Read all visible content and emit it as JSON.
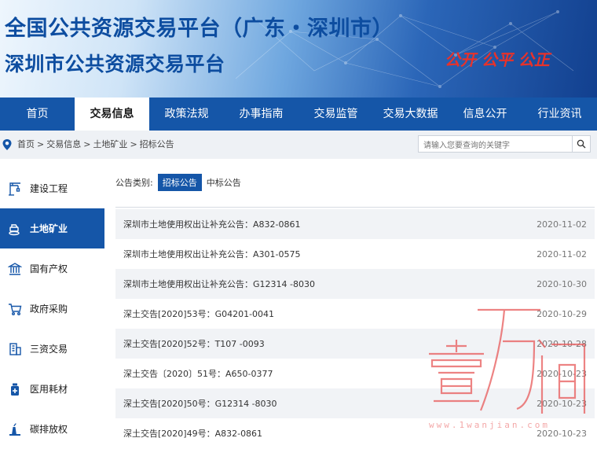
{
  "header": {
    "title_line1": "全国公共资源交易平台（广东・深圳市）",
    "title_line2": "深圳市公共资源交易平台",
    "slogan": "公开 公平 公正"
  },
  "nav": {
    "items": [
      {
        "label": "首页"
      },
      {
        "label": "交易信息",
        "active": true
      },
      {
        "label": "政策法规"
      },
      {
        "label": "办事指南"
      },
      {
        "label": "交易监管"
      },
      {
        "label": "交易大数据"
      },
      {
        "label": "信息公开"
      },
      {
        "label": "行业资讯"
      }
    ]
  },
  "breadcrumb": {
    "icon": "location-pin-icon",
    "items": [
      "首页",
      ">",
      "交易信息",
      ">",
      "土地矿业",
      ">",
      "招标公告"
    ]
  },
  "search": {
    "placeholder": "请输入您要查询的关键字",
    "icon": "search-icon"
  },
  "sidebar": {
    "items": [
      {
        "label": "建设工程",
        "icon": "crane-icon"
      },
      {
        "label": "土地矿业",
        "icon": "excavator-icon",
        "active": true
      },
      {
        "label": "国有产权",
        "icon": "bank-icon"
      },
      {
        "label": "政府采购",
        "icon": "cart-icon"
      },
      {
        "label": "三资交易",
        "icon": "building-icon"
      },
      {
        "label": "医用耗材",
        "icon": "medicine-icon"
      },
      {
        "label": "碳排放权",
        "icon": "factory-icon"
      }
    ]
  },
  "filter": {
    "label": "公告类别:",
    "options": [
      {
        "label": "招标公告",
        "active": true
      },
      {
        "label": "中标公告"
      }
    ]
  },
  "list": {
    "rows": [
      {
        "title": "深圳市土地使用权出让补充公告：A832-0861",
        "date": "2020-11-02"
      },
      {
        "title": "深圳市土地使用权出让补充公告：A301-0575",
        "date": "2020-11-02"
      },
      {
        "title": "深圳市土地使用权出让补充公告：G12314 -8030",
        "date": "2020-10-30"
      },
      {
        "title": "深土交告[2020]53号：G04201-0041",
        "date": "2020-10-29"
      },
      {
        "title": "深土交告[2020]52号：T107 -0093",
        "date": "2020-10-28"
      },
      {
        "title": "深土交告〔2020〕51号：A650-0377",
        "date": "2020-10-23"
      },
      {
        "title": "深土交告[2020]50号：G12314 -8030",
        "date": "2020-10-23"
      },
      {
        "title": "深土交告[2020]49号：A832-0861",
        "date": "2020-10-23"
      }
    ]
  },
  "watermark": {
    "glyphs": "壹万间",
    "domain": "www.1wanjian.com"
  },
  "colors": {
    "primary": "#1556a8",
    "title_blue": "#0d4da0",
    "slogan_red": "#e8322a",
    "watermark_red": "#e85a5a"
  }
}
